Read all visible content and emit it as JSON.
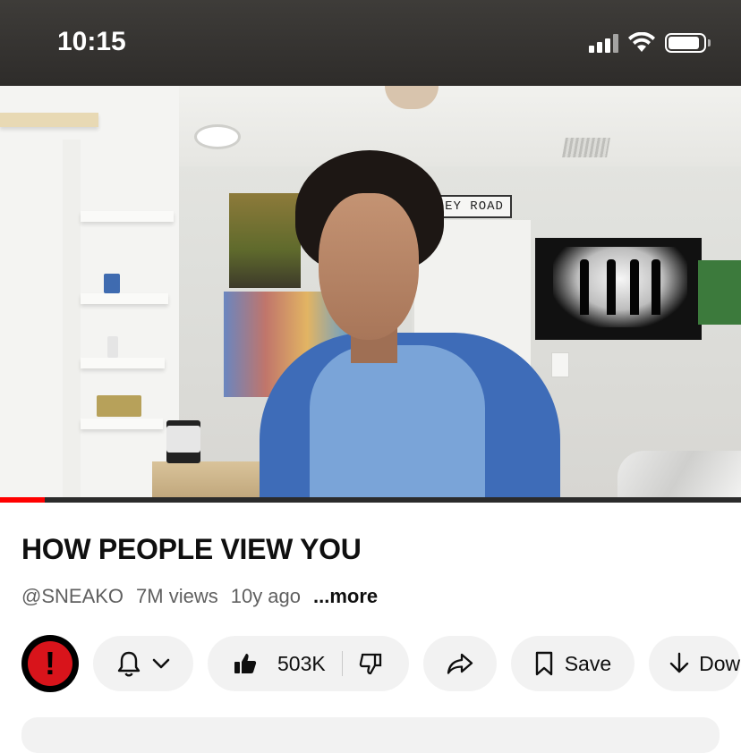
{
  "status_bar": {
    "time": "10:15",
    "icons": [
      "cellular-signal-icon",
      "wifi-icon",
      "battery-icon"
    ],
    "battery_level": 0.9
  },
  "video": {
    "background_sign_text": "EY ROAD",
    "progress": 0.06,
    "progress_color": "#ff0000"
  },
  "details": {
    "title": "HOW PEOPLE VIEW YOU",
    "channel_handle": "@SNEAKO",
    "views": "7M views",
    "age": "10y ago",
    "more_label": "...more"
  },
  "actions": {
    "avatar_icon": "exclamation-icon",
    "subscribe_bell_icon": "bell-icon",
    "like_count": "503K",
    "save_label": "Save",
    "download_label": "Dow"
  },
  "colors": {
    "accent_red": "#ff0000",
    "pill_background": "#f2f2f2",
    "text_primary": "#0f0f0f",
    "text_secondary": "#606060"
  }
}
